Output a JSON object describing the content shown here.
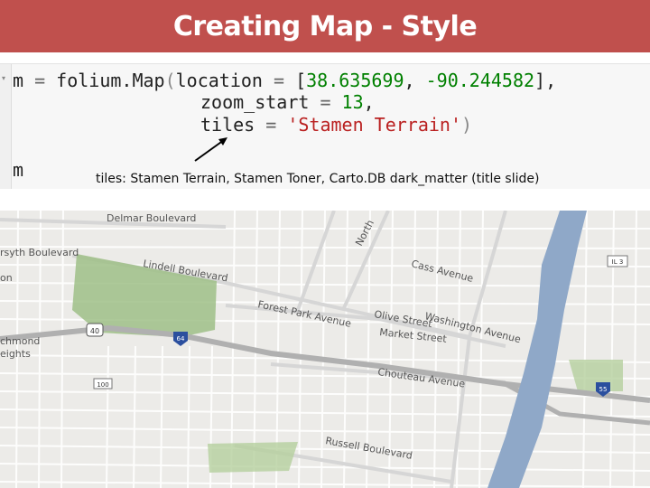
{
  "slide": {
    "title": "Creating Map - Style",
    "caption": "tiles: Stamen Terrain, Stamen Toner, Carto.DB dark_matter (title slide)"
  },
  "code": {
    "line1_var": "m",
    "line1_eq": " = ",
    "line1_call": "folium.Map",
    "line1_paren": "(",
    "line1_arg": "location",
    "line1_eq2": " = ",
    "line1_bracket_open": "[",
    "lat": "38.635699",
    "comma": ", ",
    "lon": "-90.244582",
    "line1_bracket_close": "],",
    "line2_arg": "zoom_start",
    "line2_eq": " = ",
    "zoom": "13",
    "line2_comma": ",",
    "line3_arg": "tiles",
    "line3_eq": " = ",
    "tiles": "'Stamen Terrain'",
    "line3_close": ")",
    "line4": "m"
  },
  "map": {
    "labels": {
      "delmar": "Delmar Boulevard",
      "lindell": "Lindell Boulevard",
      "forest_park": "Forest Park Avenue",
      "olive": "Olive Street",
      "market": "Market Street",
      "chouteau": "Chouteau Avenue",
      "washington": "Washington Avenue",
      "cass": "Cass Avenue",
      "russell": "Russell Boulevard",
      "north": "North",
      "richmond": "chmond",
      "heights": "eights",
      "forsyth": "rsyth Boulevard",
      "on": "on",
      "i64": "64",
      "us40": "40",
      "r100": "100",
      "i55": "55",
      "il3": "IL 3"
    },
    "colors": {
      "background": "#ecebe8",
      "park": "#9fbf87",
      "river": "#8fa8c8",
      "road": "#ffffff",
      "highway": "#bdbdbd"
    }
  }
}
